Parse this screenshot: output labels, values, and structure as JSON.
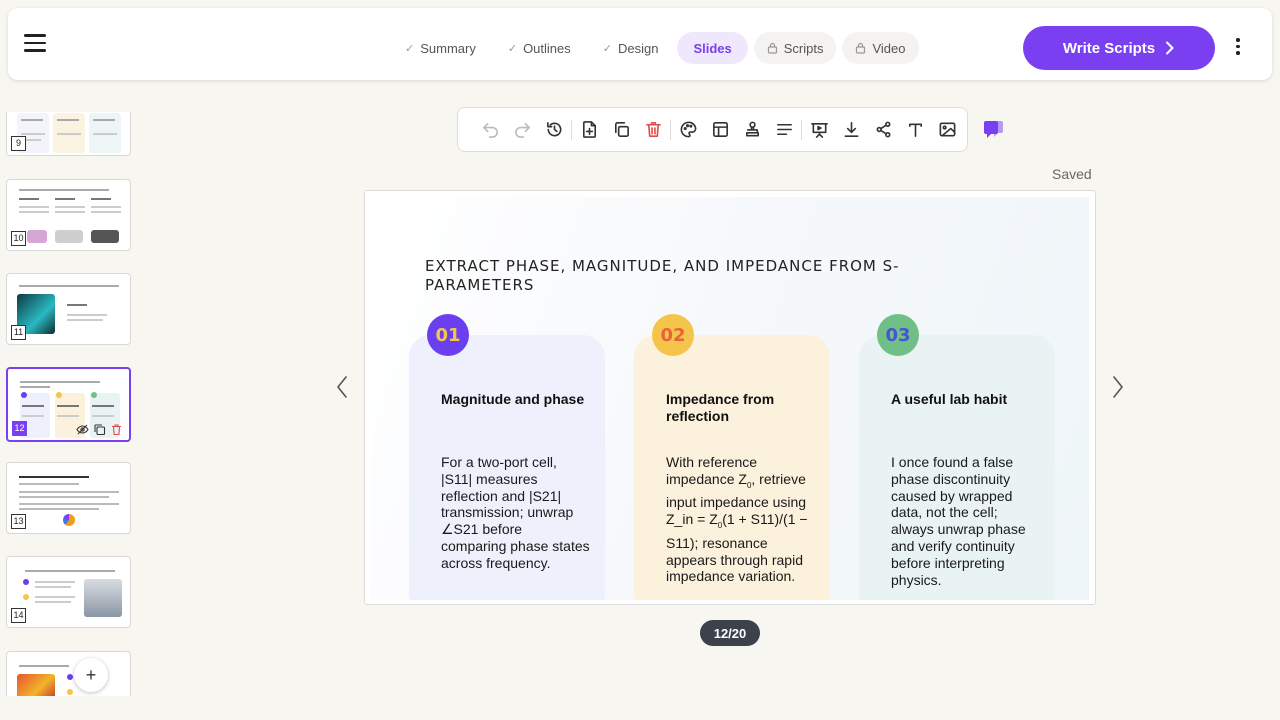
{
  "header": {
    "steps": [
      {
        "label": "Summary",
        "icon": "check-icon"
      },
      {
        "label": "Outlines",
        "icon": "check-icon"
      },
      {
        "label": "Design",
        "icon": "check-icon"
      },
      {
        "label": "Slides",
        "icon": "",
        "active": true
      },
      {
        "label": "Scripts",
        "icon": "lock-icon"
      },
      {
        "label": "Video",
        "icon": "lock-icon"
      }
    ],
    "write_button_label": "Write Scripts"
  },
  "sidebar": {
    "thumbnails": [
      {
        "number": "9"
      },
      {
        "number": "10"
      },
      {
        "number": "11"
      },
      {
        "number": "12",
        "selected": true
      },
      {
        "number": "13"
      },
      {
        "number": "14"
      },
      {
        "number": ""
      }
    ]
  },
  "editor": {
    "save_status": "Saved",
    "toolbar_icons": [
      "undo-icon",
      "redo-icon",
      "history-icon",
      "add-slide-icon",
      "duplicate-icon",
      "delete-icon",
      "theme-palette-icon",
      "layout-icon",
      "stamp-icon",
      "align-icon",
      "present-icon",
      "download-icon",
      "share-icon",
      "text-icon",
      "image-icon"
    ],
    "page_indicator": "12/20"
  },
  "slide": {
    "title": "EXTRACT PHASE, MAGNITUDE, AND IMPEDANCE FROM S-PARAMETERS",
    "cards": [
      {
        "number": "01",
        "title": "Magnitude and phase",
        "body": "For a two-port cell, |S11| measures reflection and |S21| transmission; unwrap ∠S21 before comparing phase states across frequency.",
        "badge_color": "#6a3ff0",
        "badge_text_color": "#f5c54a",
        "card_color": "#eef0fc"
      },
      {
        "number": "02",
        "title": "Impedance from reflection",
        "body_parts": [
          "With reference impedance Z",
          "0",
          ", retrieve input impedance using Z_in = Z",
          "0",
          "(1 + S11)/(1 − S11); resonance appears through rapid impedance variation."
        ],
        "badge_color": "#f4c54a",
        "badge_text_color": "#e8633a",
        "card_color": "#fbf1dc"
      },
      {
        "number": "03",
        "title": "A useful lab habit",
        "body": "I once found a false phase discontinuity caused by wrapped data, not the cell; always unwrap phase and verify continuity before interpreting physics.",
        "badge_color": "#6fbf86",
        "badge_text_color": "#4a52d8",
        "card_color": "#eaf3f4"
      }
    ]
  },
  "colors": {
    "accent": "#7b3ff2",
    "danger": "#e04b4b"
  }
}
